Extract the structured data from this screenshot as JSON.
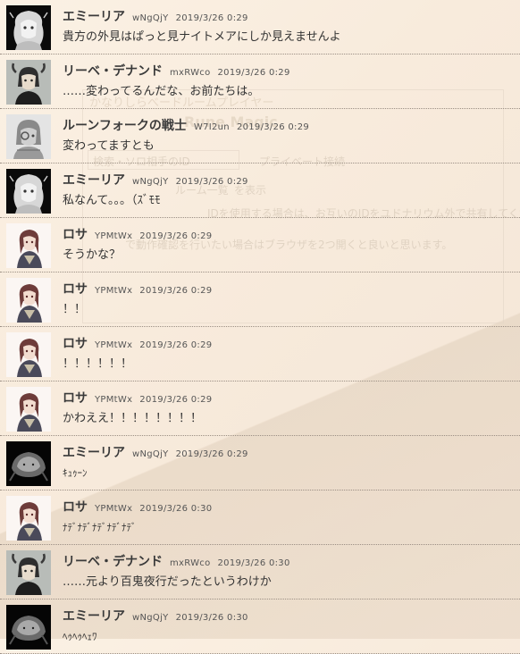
{
  "background": {
    "title": "かなりしらべードルームプレイヤー",
    "section": "Rune Magic",
    "search_placeholder": "検索・ソロ相手のID",
    "private_label": "プライベート接続",
    "partner_label": "ルーム一覧",
    "display_label": "を表示",
    "note1": "IDを使用する場合は、お互いのIDをユドナリウム外で共有してくださ",
    "note2": "で動作確認を行いたい場合はブラウザを2つ開くと良いと思います。"
  },
  "messages": [
    {
      "name": "エミーリア",
      "user_id": "wNgQjY",
      "time": "2019/3/26 0:29",
      "text": "貴方の外見はぱっと見ナイトメアにしか見えませんよ",
      "avatar": "emilia-light"
    },
    {
      "name": "リーベ・デナンド",
      "user_id": "mxRWco",
      "time": "2019/3/26 0:29",
      "text": "……変わってるんだな、お前たちは。",
      "avatar": "liebe"
    },
    {
      "name": "ルーンフォークの戦士",
      "user_id": "W7I2un",
      "time": "2019/3/26 0:29",
      "text": "変わってますとも",
      "avatar": "runefolk"
    },
    {
      "name": "エミーリア",
      "user_id": "wNgQjY",
      "time": "2019/3/26 0:29",
      "text": "私なんて。。。（ｽﾞﾓﾓ",
      "avatar": "emilia-light"
    },
    {
      "name": "ロサ",
      "user_id": "YPMtWx",
      "time": "2019/3/26 0:29",
      "text": "そうかな？",
      "avatar": "rosa"
    },
    {
      "name": "ロサ",
      "user_id": "YPMtWx",
      "time": "2019/3/26 0:29",
      "text": "！！",
      "avatar": "rosa"
    },
    {
      "name": "ロサ",
      "user_id": "YPMtWx",
      "time": "2019/3/26 0:29",
      "text": "！！！！！！",
      "avatar": "rosa"
    },
    {
      "name": "ロサ",
      "user_id": "YPMtWx",
      "time": "2019/3/26 0:29",
      "text": "かわええ！！！！！！！！",
      "avatar": "rosa"
    },
    {
      "name": "エミーリア",
      "user_id": "wNgQjY",
      "time": "2019/3/26 0:29",
      "text": "ｷｭｩｰﾝ",
      "avatar": "emilia-dark",
      "small": true
    },
    {
      "name": "ロサ",
      "user_id": "YPMtWx",
      "time": "2019/3/26 0:30",
      "text": "ﾅﾃﾞﾅﾃﾞﾅﾃﾞﾅﾃﾞﾅﾃﾞ",
      "avatar": "rosa",
      "small": true
    },
    {
      "name": "リーベ・デナンド",
      "user_id": "mxRWco",
      "time": "2019/3/26 0:30",
      "text": "……元より百鬼夜行だったというわけか",
      "avatar": "liebe"
    },
    {
      "name": "エミーリア",
      "user_id": "wNgQjY",
      "time": "2019/3/26 0:30",
      "text": "ﾍｩﾍｩﾍｪﾜ",
      "avatar": "emilia-dark",
      "small": true
    }
  ],
  "colors": {
    "background": "#f8ebdc",
    "divider": "#9b8f84",
    "name_text": "#3a3a3a"
  }
}
